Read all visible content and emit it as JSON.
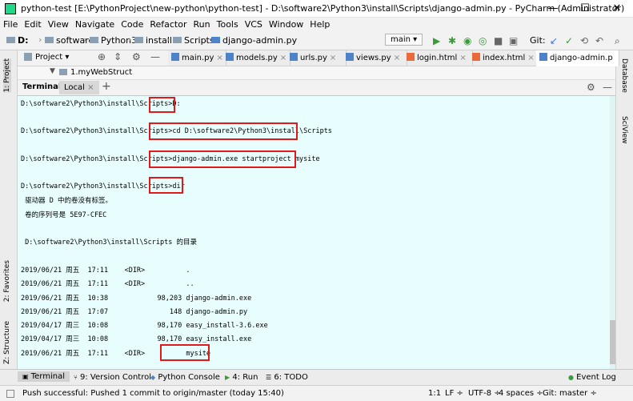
{
  "window": {
    "title": "python-test [E:\\PythonProject\\new-python\\python-test] - D:\\software2\\Python3\\install\\Scripts\\django-admin.py - PyCharm (Administrator)",
    "minimize": "—",
    "maximize": "☐",
    "close": "✕"
  },
  "menu": [
    "File",
    "Edit",
    "View",
    "Navigate",
    "Code",
    "Refactor",
    "Run",
    "Tools",
    "VCS",
    "Window",
    "Help"
  ],
  "breadcrumb": [
    "D:",
    "software2",
    "Python3",
    "install",
    "Scripts",
    "django-admin.py"
  ],
  "toolbar": {
    "run_config": "main ▾",
    "git_label": "Git:"
  },
  "project_panel": {
    "label": "Project ▾"
  },
  "tabs": [
    {
      "label": "main.py",
      "kind": "py"
    },
    {
      "label": "models.py",
      "kind": "py"
    },
    {
      "label": "urls.py",
      "kind": "py"
    },
    {
      "label": "views.py",
      "kind": "py"
    },
    {
      "label": "login.html",
      "kind": "html"
    },
    {
      "label": "index.html",
      "kind": "html"
    },
    {
      "label": "django-admin.p",
      "kind": "py"
    }
  ],
  "tree": {
    "item": "1.myWebStruct"
  },
  "terminal": {
    "title": "Terminal:",
    "tab": "Local",
    "add": "+",
    "lines": [
      "D:\\software2\\Python3\\install\\Scripts>D:",
      "D:\\software2\\Python3\\install\\Scripts>cd D:\\software2\\Python3\\install\\Scripts",
      "D:\\software2\\Python3\\install\\Scripts>django-admin.exe startproject mysite",
      "D:\\software2\\Python3\\install\\Scripts>dir",
      " 驱动器 D 中的卷没有标签。",
      " 卷的序列号是 5E97-CFEC",
      " D:\\software2\\Python3\\install\\Scripts 的目录",
      "2019/06/21 周五  17:11    <DIR>          .",
      "2019/06/21 周五  17:11    <DIR>          ..",
      "2019/06/21 周五  10:38            98,203 django-admin.exe",
      "2019/06/21 周五  17:07               148 django-admin.py",
      "2019/04/17 周三  10:08            98,170 easy_install-3.6.exe",
      "2019/04/17 周三  10:08            98,170 easy_install.exe",
      "2019/06/21 周五  17:11    <DIR>          mysite"
    ]
  },
  "side_left": [
    "1: Project",
    "2: Favorites",
    "Z: Structure"
  ],
  "side_right": [
    "Database",
    "SciView"
  ],
  "bottom_tools": [
    "Terminal",
    "9: Version Control",
    "Python Console",
    "4: Run",
    "6: TODO",
    "Event Log"
  ],
  "status": {
    "message": "Push successful: Pushed 1 commit to origin/master (today 15:40)",
    "position": "1:1",
    "line_sep": "LF ÷",
    "encoding": "UTF-8 ÷",
    "indent": "4 spaces ÷",
    "branch": "Git: master ÷"
  }
}
